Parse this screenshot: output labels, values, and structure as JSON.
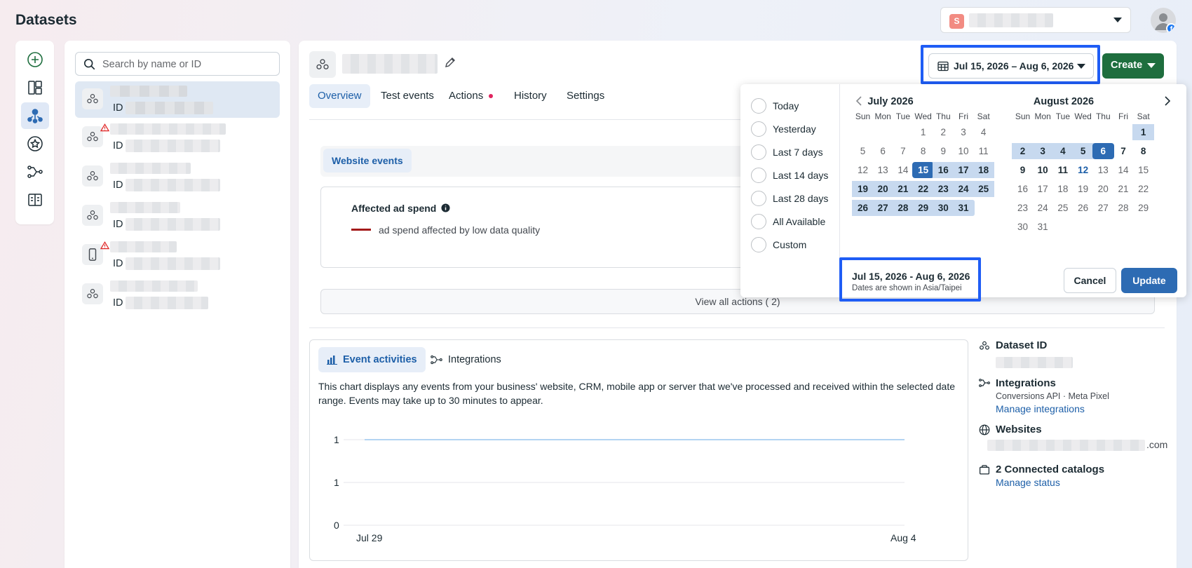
{
  "page": {
    "title": "Datasets"
  },
  "account": {
    "badge": "S"
  },
  "search": {
    "placeholder": "Search by name or ID"
  },
  "datasets": {
    "id_label": "ID",
    "items": [
      {
        "type": "pixel",
        "warning": false,
        "selected": true
      },
      {
        "type": "pixel",
        "warning": true,
        "selected": false
      },
      {
        "type": "pixel",
        "warning": false,
        "selected": false
      },
      {
        "type": "pixel",
        "warning": false,
        "selected": false
      },
      {
        "type": "mobile",
        "warning": true,
        "selected": false
      },
      {
        "type": "pixel",
        "warning": false,
        "selected": false
      }
    ]
  },
  "tabs": {
    "overview": "Overview",
    "test_events": "Test events",
    "actions": "Actions",
    "history": "History",
    "settings": "Settings"
  },
  "overview": {
    "subtab": "Website events",
    "affected_title": "Affected ad spend",
    "affected_legend": "ad spend affected by low data quality",
    "view_actions": "View all actions ( 2)"
  },
  "events": {
    "tab_activities": "Event activities",
    "tab_integrations": "Integrations",
    "description": "This chart displays any events from your business' website, CRM, mobile app or server that we've processed and received within the selected date range. Events may take up to 30 minutes to appear."
  },
  "chart_data": {
    "type": "line",
    "x": [
      "Jul 29",
      "Aug 4"
    ],
    "y_ticks": [
      "1",
      "1",
      "0"
    ],
    "series": [
      {
        "values": [
          1,
          1
        ]
      }
    ]
  },
  "side_info": {
    "dataset_id_title": "Dataset ID",
    "integrations_title": "Integrations",
    "integrations_sub": "Conversions API · Meta Pixel",
    "manage_integrations": "Manage integrations",
    "websites_title": "Websites",
    "website_suffix": ".com",
    "catalogs_title": "2 Connected catalogs",
    "manage_status": "Manage status"
  },
  "toolbar": {
    "date_range": "Jul 15, 2026 – Aug 6, 2026",
    "create_label": "Create"
  },
  "date_picker": {
    "presets": [
      "Today",
      "Yesterday",
      "Last 7 days",
      "Last 14 days",
      "Last 28 days",
      "All Available",
      "Custom"
    ],
    "dow": [
      "Sun",
      "Mon",
      "Tue",
      "Wed",
      "Thu",
      "Fri",
      "Sat"
    ],
    "month_left": {
      "title": "July 2026",
      "weeks": [
        [
          "",
          "",
          "",
          "1",
          "2",
          "3",
          "4"
        ],
        [
          "5",
          "6",
          "7",
          "8",
          "9",
          "10",
          "11"
        ],
        [
          "12",
          "13",
          "14",
          "15",
          "16",
          "17",
          "18"
        ],
        [
          "19",
          "20",
          "21",
          "22",
          "23",
          "24",
          "25"
        ],
        [
          "26",
          "27",
          "28",
          "29",
          "30",
          "31",
          ""
        ]
      ]
    },
    "month_right": {
      "title": "August 2026",
      "weeks": [
        [
          "",
          "",
          "",
          "",
          "",
          "",
          "1"
        ],
        [
          "2",
          "3",
          "4",
          "5",
          "6",
          "7",
          "8"
        ],
        [
          "9",
          "10",
          "11",
          "12",
          "13",
          "14",
          "15"
        ],
        [
          "16",
          "17",
          "18",
          "19",
          "20",
          "21",
          "22"
        ],
        [
          "23",
          "24",
          "25",
          "26",
          "27",
          "28",
          "29"
        ],
        [
          "30",
          "31",
          "",
          "",
          "",
          "",
          ""
        ]
      ]
    },
    "range_start": "Jul 15",
    "range_end": "Aug 6",
    "today": "Aug 12",
    "selected_text": "Jul 15, 2026 - Aug 6, 2026",
    "timezone_note": "Dates are shown in Asia/Taipei",
    "cancel": "Cancel",
    "update": "Update"
  },
  "colors": {
    "accent": "#2d6bb3",
    "range_fill": "#c7d9ef",
    "create_green": "#1e6e3e",
    "highlight": "#1f5df5",
    "warning": "#e02424"
  }
}
